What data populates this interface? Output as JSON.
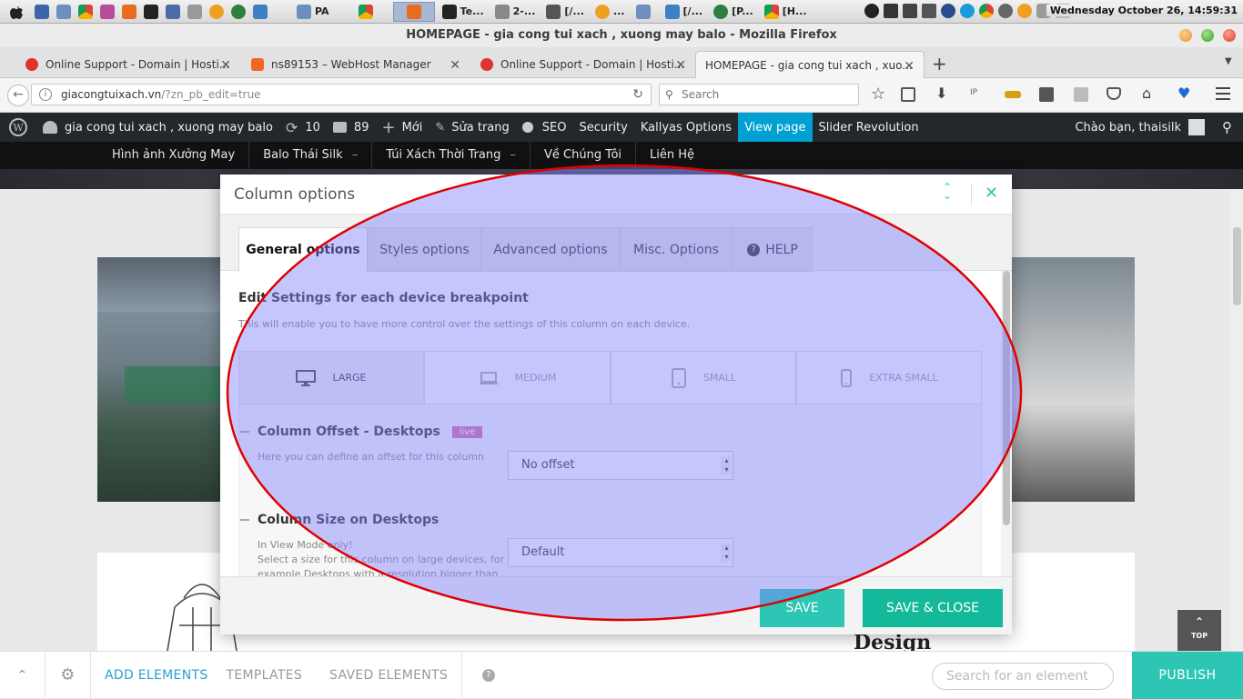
{
  "os": {
    "clock": "Wednesday October 26, 14:59:31",
    "tasks": [
      "PA",
      "Te...",
      "2-...",
      "[/...",
      "...",
      "[/...",
      "[P...",
      "[H..."
    ]
  },
  "firefox": {
    "window_title": "HOMEPAGE - gia cong tui xach , xuong may balo - Mozilla Firefox",
    "tabs": [
      {
        "label": "Online Support - Domain | Hosti..."
      },
      {
        "label": "ns89153 – WebHost Manager"
      },
      {
        "label": "Online Support - Domain | Hosti..."
      },
      {
        "label": "HOMEPAGE - gia cong tui xach , xuo..."
      }
    ],
    "url_host": "giacongtuixach.vn",
    "url_path": "/?zn_pb_edit=true",
    "search_placeholder": "Search"
  },
  "wp_admin": {
    "site_name": "gia cong tui xach , xuong may balo",
    "updates": "10",
    "comments": "89",
    "new": "Mới",
    "edit_page": "Sửa trang",
    "seo": "SEO",
    "security": "Security",
    "kallyas": "Kallyas Options",
    "view_page": "View page",
    "slider": "Slider Revolution",
    "greeting": "Chào bạn, thaisilk"
  },
  "site_nav": [
    "Hình ảnh Xưởng May",
    "Balo Thái Silk",
    "Túi Xách Thời Trang",
    "Về Chúng Tôi",
    "Liên Hệ"
  ],
  "site": {
    "design_heading": "Design",
    "top_label": "TOP"
  },
  "modal": {
    "title": "Column options",
    "tabs": [
      "General options",
      "Styles options",
      "Advanced options",
      "Misc. Options",
      "HELP"
    ],
    "section_title": "Edit Settings for each device breakpoint",
    "section_desc": "This will enable you to have more control over the settings of this column on each device.",
    "breakpoints": [
      "LARGE",
      "MEDIUM",
      "SMALL",
      "EXTRA SMALL"
    ],
    "offset": {
      "label": "Column Offset - Desktops",
      "badge": "live",
      "desc": "Here you can define an offset for this column",
      "value": "No offset"
    },
    "size": {
      "label": "Column Size on Desktops",
      "desc1": "In View Mode only!",
      "desc2": "Select a size for this column on large devices, for",
      "desc3": "example Desktops with a resolution bigger than",
      "value": "Default"
    },
    "save": "SAVE",
    "save_close": "SAVE & CLOSE"
  },
  "builder": {
    "add_elements": "ADD ELEMENTS",
    "templates": "TEMPLATES",
    "saved_elements": "SAVED ELEMENTS",
    "search_placeholder": "Search for an element",
    "publish": "PUBLISH"
  },
  "colors": {
    "accent": "#2dc6b5",
    "wp_highlight": "#00a0d2",
    "overlay_fill": "#8080ff",
    "overlay_ring": "#e00000"
  }
}
